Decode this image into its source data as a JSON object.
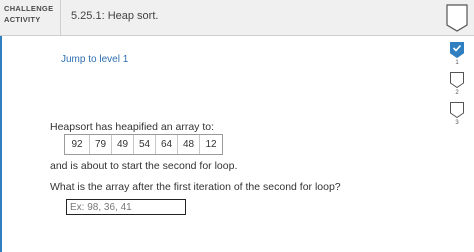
{
  "header": {
    "category": "CHALLENGE ACTIVITY",
    "title": "5.25.1: Heap sort."
  },
  "jump_link": "Jump to level 1",
  "levels": [
    {
      "number": "1",
      "state": "completed"
    },
    {
      "number": "2",
      "state": "incomplete"
    },
    {
      "number": "3",
      "state": "incomplete"
    }
  ],
  "content": {
    "intro": "Heapsort has heapified an array to:",
    "array": [
      "92",
      "79",
      "49",
      "54",
      "64",
      "48",
      "12"
    ],
    "followup": "and is about to start the second for loop.",
    "question": "What is the array after the first iteration of the second for loop?",
    "answer_value": "",
    "answer_placeholder": "Ex: 98, 36, 41"
  },
  "colors": {
    "accent": "#2f7fc1",
    "link": "#2f6fb0",
    "header_bg": "#f0f0f0"
  }
}
